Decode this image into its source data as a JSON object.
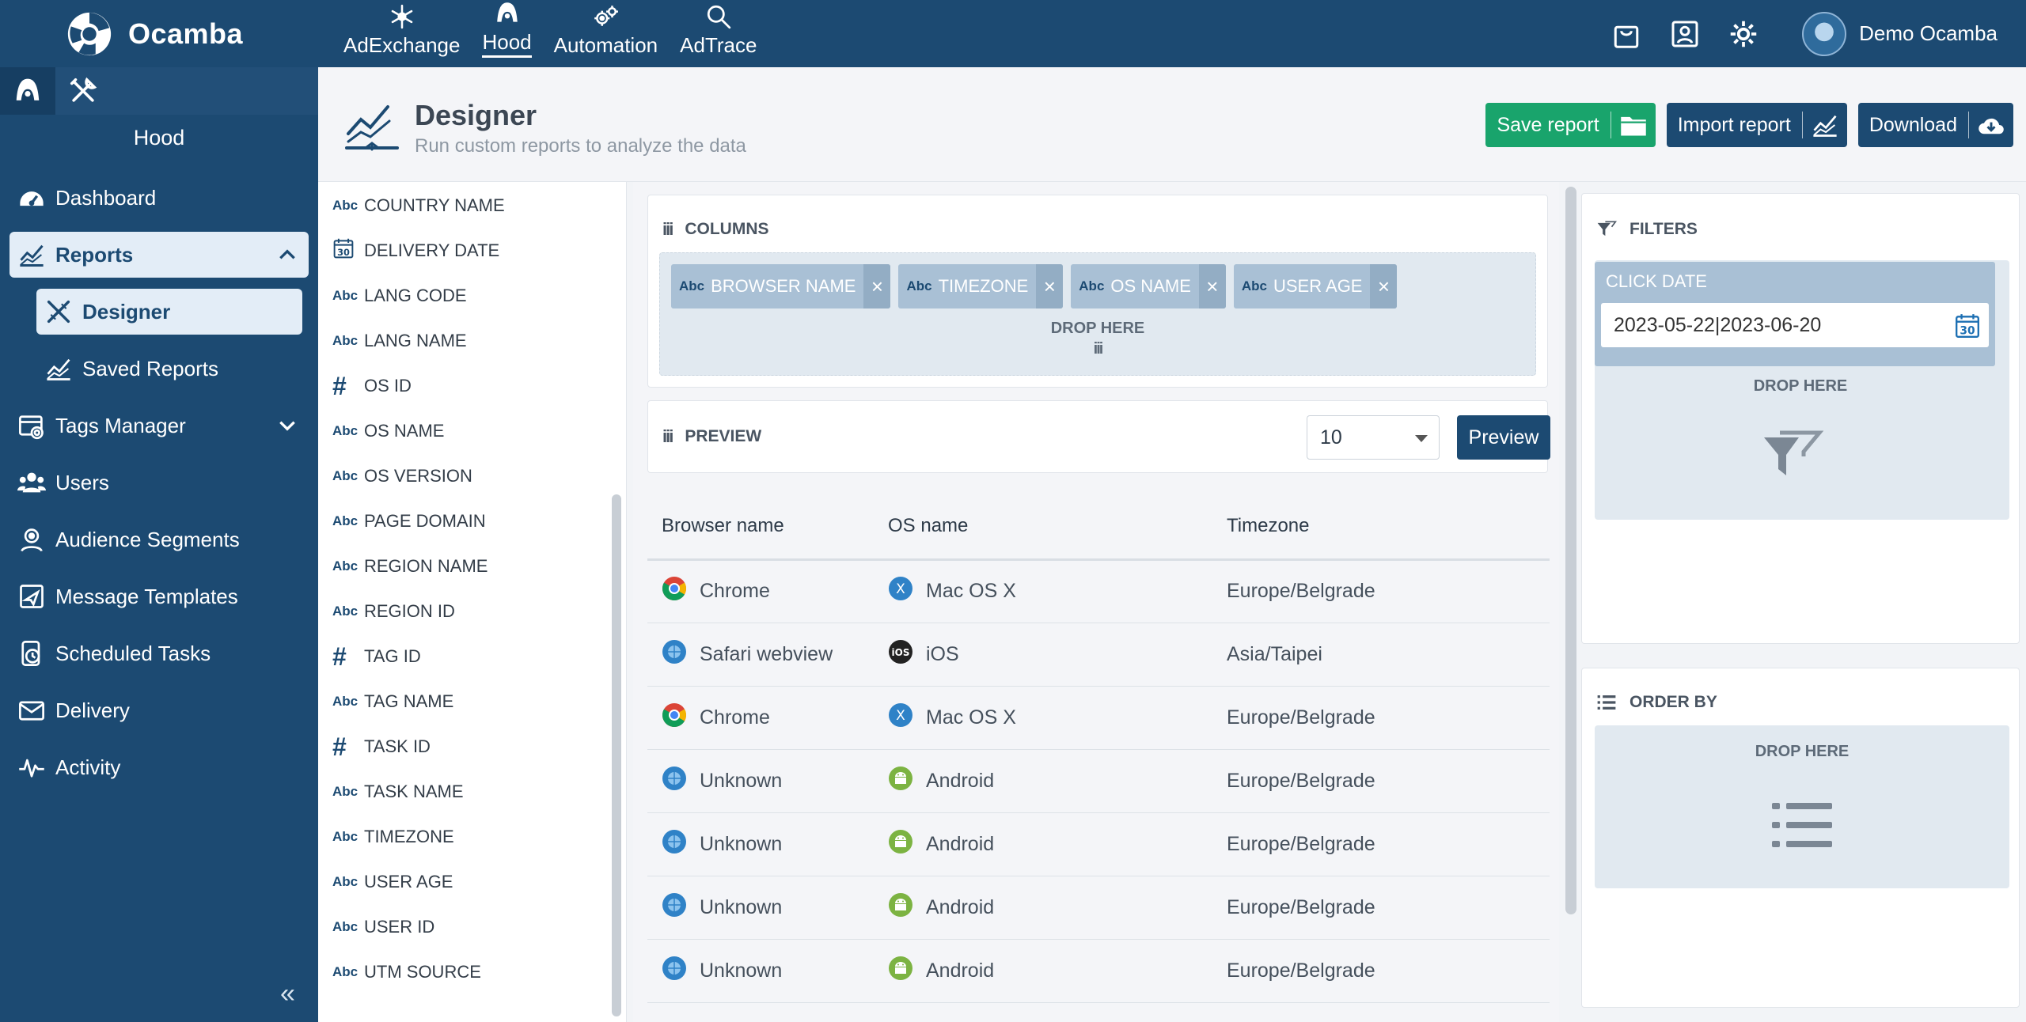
{
  "brand": {
    "name": "Ocamba"
  },
  "topnav": [
    {
      "label": "AdExchange",
      "icon": "snowflake-icon"
    },
    {
      "label": "Hood",
      "icon": "hood-icon",
      "active": true
    },
    {
      "label": "Automation",
      "icon": "gears-icon"
    },
    {
      "label": "AdTrace",
      "icon": "search-icon"
    }
  ],
  "user": {
    "name": "Demo Ocamba"
  },
  "sidebar": {
    "title": "Hood",
    "items": [
      {
        "label": "Dashboard",
        "icon": "dashboard-icon"
      },
      {
        "label": "Reports",
        "icon": "chart-icon",
        "open": true
      },
      {
        "label": "Designer",
        "icon": "designer-icon",
        "sub": true,
        "active": true
      },
      {
        "label": "Saved Reports",
        "icon": "chart-icon",
        "sub": true
      },
      {
        "label": "Tags Manager",
        "icon": "tags-icon",
        "chevron": true
      },
      {
        "label": "Users",
        "icon": "users-icon"
      },
      {
        "label": "Audience Segments",
        "icon": "audience-icon"
      },
      {
        "label": "Message Templates",
        "icon": "message-icon"
      },
      {
        "label": "Scheduled Tasks",
        "icon": "clock-icon"
      },
      {
        "label": "Delivery",
        "icon": "envelope-icon"
      },
      {
        "label": "Activity",
        "icon": "activity-icon"
      }
    ],
    "collapse": "«"
  },
  "header": {
    "title": "Designer",
    "subtitle": "Run custom reports to analyze the data",
    "buttons": {
      "save": "Save report",
      "import": "Import report",
      "download": "Download"
    }
  },
  "fields": [
    {
      "type": "Abc",
      "name": "COUNTRY NAME"
    },
    {
      "type": "date",
      "name": "DELIVERY DATE"
    },
    {
      "type": "Abc",
      "name": "LANG CODE"
    },
    {
      "type": "Abc",
      "name": "LANG NAME"
    },
    {
      "type": "#",
      "name": "OS ID"
    },
    {
      "type": "Abc",
      "name": "OS NAME"
    },
    {
      "type": "Abc",
      "name": "OS VERSION"
    },
    {
      "type": "Abc",
      "name": "PAGE DOMAIN"
    },
    {
      "type": "Abc",
      "name": "REGION NAME"
    },
    {
      "type": "Abc",
      "name": "REGION ID"
    },
    {
      "type": "#",
      "name": "TAG ID"
    },
    {
      "type": "Abc",
      "name": "TAG NAME"
    },
    {
      "type": "#",
      "name": "TASK ID"
    },
    {
      "type": "Abc",
      "name": "TASK NAME"
    },
    {
      "type": "Abc",
      "name": "TIMEZONE"
    },
    {
      "type": "Abc",
      "name": "USER AGE"
    },
    {
      "type": "Abc",
      "name": "USER ID"
    },
    {
      "type": "Abc",
      "name": "UTM SOURCE"
    }
  ],
  "columns": {
    "title": "COLUMNS",
    "grip": "iii",
    "chips": [
      {
        "type": "Abc",
        "label": "BROWSER NAME"
      },
      {
        "type": "Abc",
        "label": "TIMEZONE"
      },
      {
        "type": "Abc",
        "label": "OS NAME"
      },
      {
        "type": "Abc",
        "label": "USER AGE"
      }
    ],
    "drop": "DROP HERE",
    "drop_grip": "iii"
  },
  "preview": {
    "title": "PREVIEW",
    "grip": "iii",
    "limit": "10",
    "button": "Preview"
  },
  "table": {
    "headers": [
      "Browser name",
      "OS name",
      "Timezone"
    ],
    "rows": [
      {
        "browser": "Chrome",
        "browser_icon": "chrome-icon",
        "os": "Mac OS X",
        "os_icon": "macos-icon",
        "tz": "Europe/Belgrade"
      },
      {
        "browser": "Safari webview",
        "browser_icon": "globe-icon",
        "os": "iOS",
        "os_icon": "ios-icon",
        "tz": "Asia/Taipei"
      },
      {
        "browser": "Chrome",
        "browser_icon": "chrome-icon",
        "os": "Mac OS X",
        "os_icon": "macos-icon",
        "tz": "Europe/Belgrade"
      },
      {
        "browser": "Unknown",
        "browser_icon": "globe-icon",
        "os": "Android",
        "os_icon": "android-icon",
        "tz": "Europe/Belgrade"
      },
      {
        "browser": "Unknown",
        "browser_icon": "globe-icon",
        "os": "Android",
        "os_icon": "android-icon",
        "tz": "Europe/Belgrade"
      },
      {
        "browser": "Unknown",
        "browser_icon": "globe-icon",
        "os": "Android",
        "os_icon": "android-icon",
        "tz": "Europe/Belgrade"
      },
      {
        "browser": "Unknown",
        "browser_icon": "globe-icon",
        "os": "Android",
        "os_icon": "android-icon",
        "tz": "Europe/Belgrade"
      }
    ]
  },
  "filters": {
    "title": "FILTERS",
    "filter_label": "CLICK DATE",
    "filter_value": "2023-05-22|2023-06-20",
    "drop": "DROP HERE"
  },
  "orderby": {
    "title": "ORDER BY",
    "drop": "DROP HERE"
  },
  "colors": {
    "primary": "#1c4a72",
    "green": "#19a46c",
    "chip": "#a9c0d5"
  }
}
